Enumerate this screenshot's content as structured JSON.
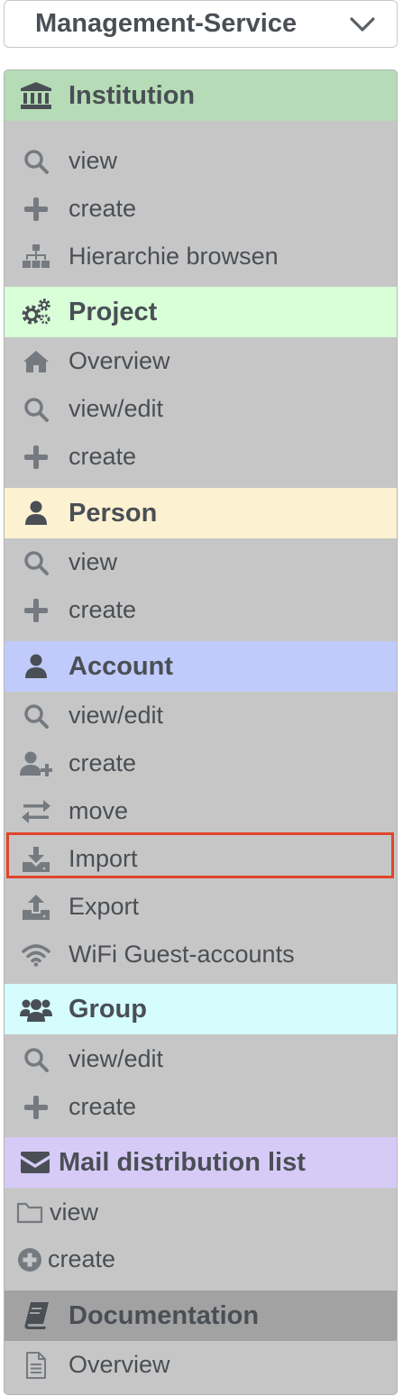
{
  "service_select": {
    "value": "Management-Service"
  },
  "menu": {
    "institution": {
      "title": "Institution",
      "bg": "#b5dcb6",
      "items": [
        "view",
        "create",
        "Hierarchie browsen"
      ]
    },
    "project": {
      "title": "Project",
      "bg": "#d8ffd8",
      "items": [
        "Overview",
        "view/edit",
        "create"
      ]
    },
    "person": {
      "title": "Person",
      "bg": "#fcf2d2",
      "items": [
        "view",
        "create"
      ]
    },
    "account": {
      "title": "Account",
      "bg": "#c0cbfb",
      "items": [
        "view/edit",
        "create",
        "move",
        "Import",
        "Export",
        "WiFi Guest-accounts"
      ]
    },
    "group": {
      "title": "Group",
      "bg": "#d5fdfd",
      "items": [
        "view/edit",
        "create"
      ]
    },
    "mail": {
      "title": "Mail distribution list",
      "bg": "#d6cbf7",
      "items": [
        "view",
        "create"
      ]
    },
    "documentation": {
      "title": "Documentation",
      "bg": "#a2a2a2",
      "items": [
        "Overview"
      ]
    }
  },
  "highlighted_item": "Import"
}
